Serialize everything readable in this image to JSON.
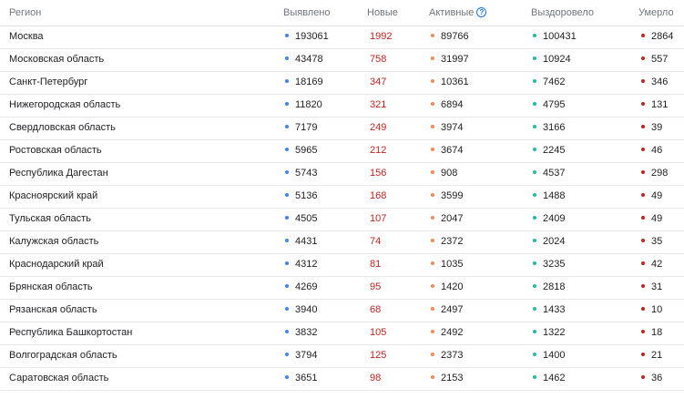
{
  "header": {
    "region": "Регион",
    "detected": "Выявлено",
    "new": "Новые",
    "active": "Активные",
    "active_info_icon": "?",
    "recovered": "Выздоровело",
    "died": "Умерло"
  },
  "colors": {
    "detected_dot": "#4285f4",
    "new_text": "#c5221f",
    "active_dot": "#f28b55",
    "recovered_dot": "#26b9a6",
    "died_dot": "#c5221f"
  },
  "rows": [
    {
      "region": "Москва",
      "detected": "193061",
      "new": "1992",
      "active": "89766",
      "recovered": "100431",
      "died": "2864"
    },
    {
      "region": "Московская область",
      "detected": "43478",
      "new": "758",
      "active": "31997",
      "recovered": "10924",
      "died": "557"
    },
    {
      "region": "Санкт-Петербург",
      "detected": "18169",
      "new": "347",
      "active": "10361",
      "recovered": "7462",
      "died": "346"
    },
    {
      "region": "Нижегородская область",
      "detected": "11820",
      "new": "321",
      "active": "6894",
      "recovered": "4795",
      "died": "131"
    },
    {
      "region": "Свердловская область",
      "detected": "7179",
      "new": "249",
      "active": "3974",
      "recovered": "3166",
      "died": "39"
    },
    {
      "region": "Ростовская область",
      "detected": "5965",
      "new": "212",
      "active": "3674",
      "recovered": "2245",
      "died": "46"
    },
    {
      "region": "Республика Дагестан",
      "detected": "5743",
      "new": "156",
      "active": "908",
      "recovered": "4537",
      "died": "298"
    },
    {
      "region": "Красноярский край",
      "detected": "5136",
      "new": "168",
      "active": "3599",
      "recovered": "1488",
      "died": "49"
    },
    {
      "region": "Тульская область",
      "detected": "4505",
      "new": "107",
      "active": "2047",
      "recovered": "2409",
      "died": "49"
    },
    {
      "region": "Калужская область",
      "detected": "4431",
      "new": "74",
      "active": "2372",
      "recovered": "2024",
      "died": "35"
    },
    {
      "region": "Краснодарский край",
      "detected": "4312",
      "new": "81",
      "active": "1035",
      "recovered": "3235",
      "died": "42"
    },
    {
      "region": "Брянская область",
      "detected": "4269",
      "new": "95",
      "active": "1420",
      "recovered": "2818",
      "died": "31"
    },
    {
      "region": "Рязанская область",
      "detected": "3940",
      "new": "68",
      "active": "2497",
      "recovered": "1433",
      "died": "10"
    },
    {
      "region": "Республика Башкортостан",
      "detected": "3832",
      "new": "105",
      "active": "2492",
      "recovered": "1322",
      "died": "18"
    },
    {
      "region": "Волгоградская область",
      "detected": "3794",
      "new": "125",
      "active": "2373",
      "recovered": "1400",
      "died": "21"
    },
    {
      "region": "Саратовская область",
      "detected": "3651",
      "new": "98",
      "active": "2153",
      "recovered": "1462",
      "died": "36"
    }
  ]
}
